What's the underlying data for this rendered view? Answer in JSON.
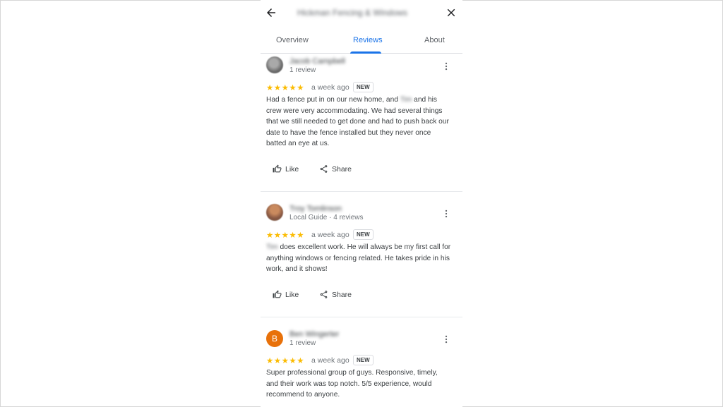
{
  "header": {
    "business_name": "Hickman Fencing & Windows",
    "back_icon": "arrow-back-icon",
    "close_icon": "close-icon"
  },
  "tabs": [
    {
      "label": "Overview",
      "active": false
    },
    {
      "label": "Reviews",
      "active": true
    },
    {
      "label": "About",
      "active": false
    }
  ],
  "colors": {
    "accent": "#1a73e8",
    "star": "#fbbc04",
    "avatar_letter_bg": "#e8710a"
  },
  "reviews": [
    {
      "author": "Jacob Campbell",
      "meta": "1 review",
      "stars": "★★★★★",
      "rating": 5,
      "date": "a week ago",
      "badge": "NEW",
      "text_before": "Had a fence put in on our new home, and ",
      "hidden_name": "Tim",
      "text_after": " and his crew were very accommodating. We had several things that we still needed to get done and had to push back our date to have the fence installed but they never once batted an eye at us.",
      "like_label": "Like",
      "share_label": "Share"
    },
    {
      "author": "Troy Tomlinson",
      "meta": "Local Guide · 4 reviews",
      "stars": "★★★★★",
      "rating": 5,
      "date": "a week ago",
      "badge": "NEW",
      "text_before": "",
      "hidden_name": "Tim",
      "text_after": " does excellent work. He will always be my first call for anything windows or fencing related. He takes pride in his work, and it shows!",
      "like_label": "Like",
      "share_label": "Share"
    },
    {
      "author": "Ben Wingerter",
      "avatar_letter": "B",
      "meta": "1 review",
      "stars": "★★★★★",
      "rating": 5,
      "date": "a week ago",
      "badge": "NEW",
      "text_before": "Super professional group of guys. Responsive, timely, and their work was top notch. 5/5 experience,  would recommend to anyone.",
      "hidden_name": "",
      "text_after": "",
      "like_label": "Like",
      "share_label": "Share"
    }
  ]
}
